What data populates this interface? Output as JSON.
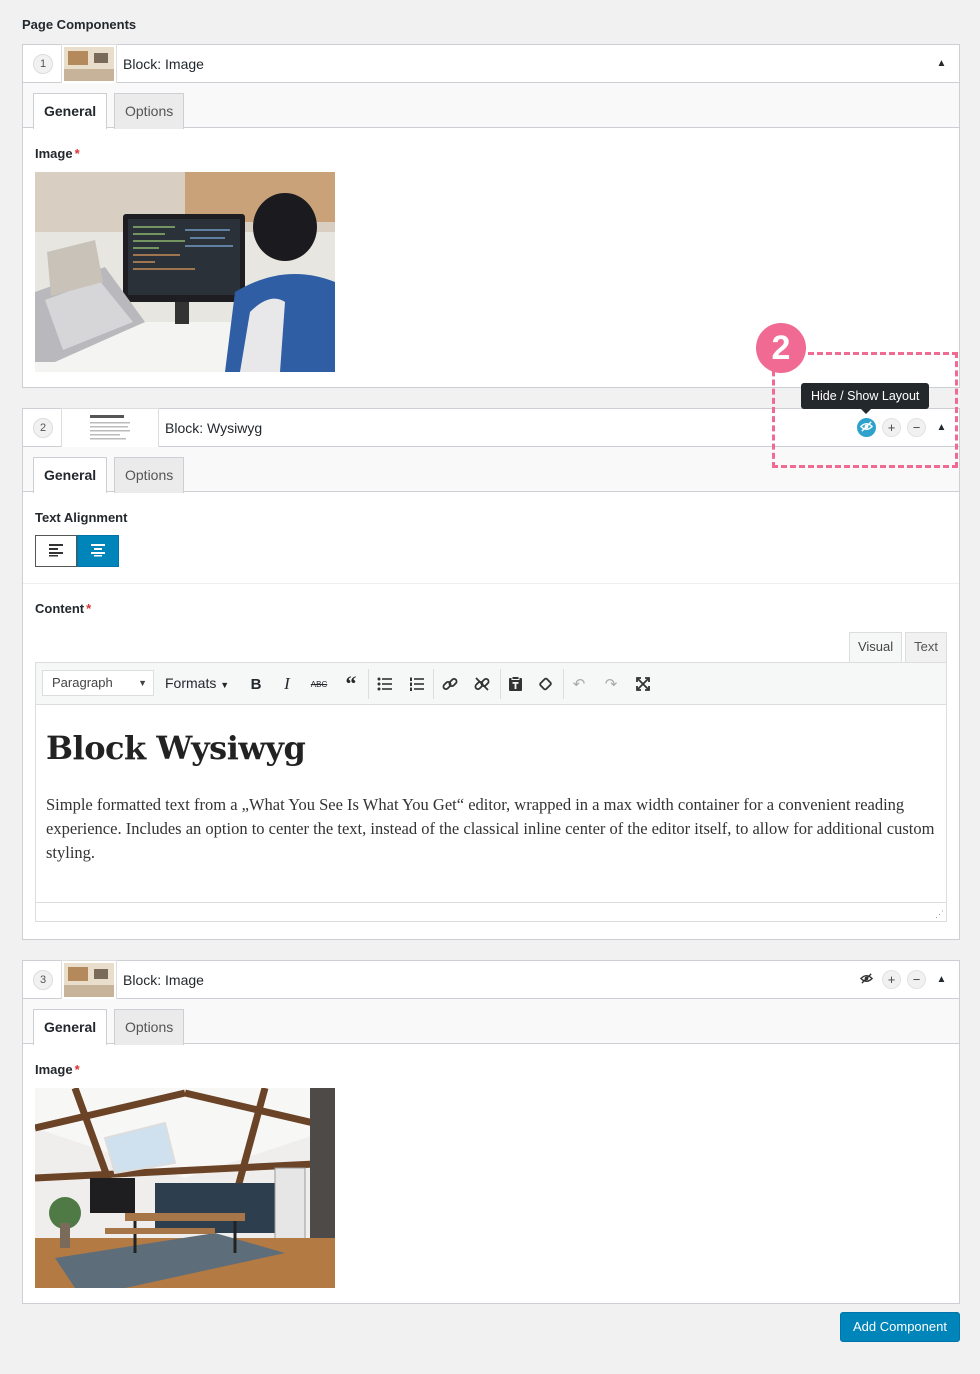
{
  "section_title": "Page Components",
  "components": [
    {
      "index": "1",
      "label": "Block: Image",
      "tabs": [
        "General",
        "Options"
      ],
      "field_label": "Image",
      "required_mark": "*"
    },
    {
      "index": "2",
      "label": "Block: Wysiwyg",
      "tabs": [
        "General",
        "Options"
      ],
      "alignment_label": "Text Alignment",
      "content_label": "Content",
      "required_mark": "*",
      "editor_tabs": [
        "Visual",
        "Text"
      ],
      "toolbar": {
        "paragraph_select": "Paragraph",
        "formats": "Formats"
      },
      "editor_heading": "Block Wysiwyg",
      "editor_text": "Simple formatted text from a „What You See Is What You Get“ editor, wrapped in a max width container for a convenient reading experience. Includes an option to center the text, instead of the classical inline center of the editor itself, to allow for additional custom styling."
    },
    {
      "index": "3",
      "label": "Block: Image",
      "tabs": [
        "General",
        "Options"
      ],
      "field_label": "Image",
      "required_mark": "*"
    }
  ],
  "tooltip": "Hide / Show Layout",
  "annotation_number": "2",
  "add_button": "Add Component",
  "colors": {
    "primary": "#0085ba",
    "annotation": "#f06a93",
    "eye_active": "#2ea2cc"
  }
}
